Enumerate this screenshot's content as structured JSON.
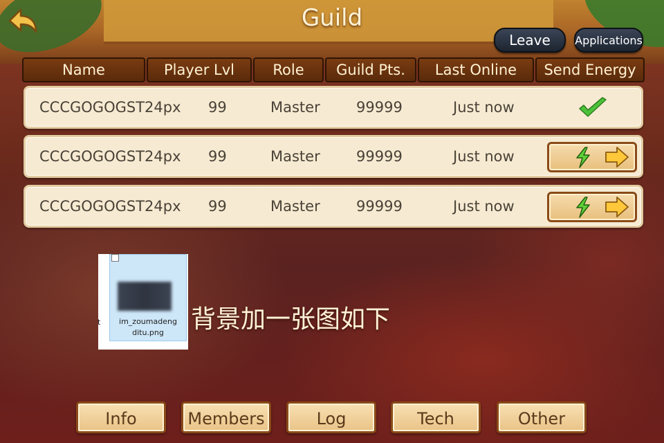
{
  "header": {
    "title": "Guild",
    "leave_label": "Leave",
    "applications_label": "Applications"
  },
  "table": {
    "columns": [
      "Name",
      "Player Lvl",
      "Role",
      "Guild Pts.",
      "Last Online",
      "Send Energy"
    ],
    "rows": [
      {
        "name": "CCCGOGOGST24px",
        "level": "99",
        "role": "Master",
        "points": "99999",
        "last_online": "Just now",
        "send_energy": "sent-checkmark"
      },
      {
        "name": "CCCGOGOGST24px",
        "level": "99",
        "role": "Master",
        "points": "99999",
        "last_online": "Just now",
        "send_energy": "send-button"
      },
      {
        "name": "CCCGOGOGST24px",
        "level": "99",
        "role": "Master",
        "points": "99999",
        "last_online": "Just now",
        "send_energy": "send-button"
      }
    ]
  },
  "attachment": {
    "filename_line1": "im_zoumadeng",
    "filename_line2": "ditu.png",
    "edge_char": "t",
    "note": "背景加一张图如下"
  },
  "tabs": [
    "Info",
    "Members",
    "Log",
    "Tech",
    "Other"
  ],
  "icons": {
    "back": "back-arrow-icon",
    "check": "checkmark-icon",
    "energy": "lightning-icon",
    "arrow": "arrow-right-icon"
  },
  "colors": {
    "header_cell": "#6b320f",
    "row_bg": "#f6ead2",
    "button_bg": "#efcb8f",
    "text_light": "#fff2d6"
  }
}
